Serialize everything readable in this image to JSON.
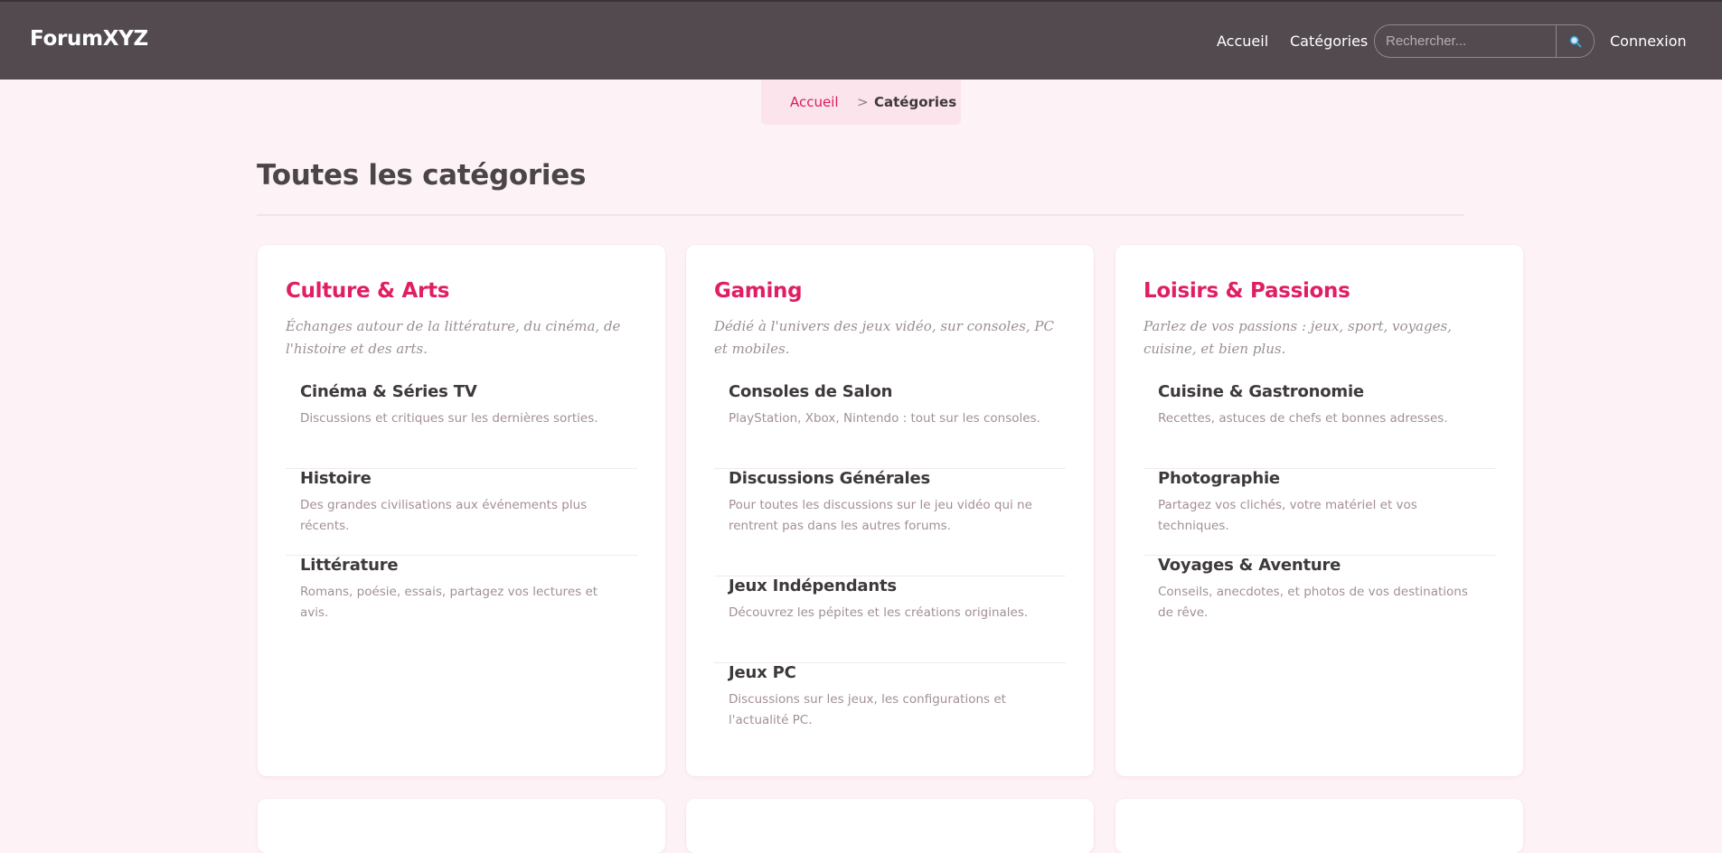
{
  "header": {
    "brand": "ForumXYZ",
    "nav": {
      "home": "Accueil",
      "categories": "Catégories",
      "login": "Connexion"
    },
    "search": {
      "placeholder": "Rechercher...",
      "value": "",
      "button_icon": "search-icon"
    }
  },
  "breadcrumb": {
    "home": "Accueil",
    "separator": ">",
    "current": "Catégories"
  },
  "page": {
    "title": "Toutes les catégories"
  },
  "categories": [
    {
      "title": "Culture & Arts",
      "description": "Échanges autour de la littérature, du cinéma, de l'histoire et des arts.",
      "forums": [
        {
          "name": "Cinéma & Séries TV",
          "description": "Discussions et critiques sur les dernières sorties."
        },
        {
          "name": "Histoire",
          "description": "Des grandes civilisations aux événements plus récents."
        },
        {
          "name": "Littérature",
          "description": "Romans, poésie, essais, partagez vos lectures et avis."
        }
      ]
    },
    {
      "title": "Gaming",
      "description": "Dédié à l'univers des jeux vidéo, sur consoles, PC et mobiles.",
      "forums": [
        {
          "name": "Consoles de Salon",
          "description": "PlayStation, Xbox, Nintendo : tout sur les consoles."
        },
        {
          "name": "Discussions Générales",
          "description": "Pour toutes les discussions sur le jeu vidéo qui ne rentrent pas dans les autres forums."
        },
        {
          "name": "Jeux Indépendants",
          "description": "Découvrez les pépites et les créations originales."
        },
        {
          "name": "Jeux PC",
          "description": "Discussions sur les jeux, les configurations et l'actualité PC."
        }
      ]
    },
    {
      "title": "Loisirs & Passions",
      "description": "Parlez de vos passions : jeux, sport, voyages, cuisine, et bien plus.",
      "forums": [
        {
          "name": "Cuisine & Gastronomie",
          "description": "Recettes, astuces de chefs et bonnes adresses."
        },
        {
          "name": "Photographie",
          "description": "Partagez vos clichés, votre matériel et vos techniques."
        },
        {
          "name": "Voyages & Aventure",
          "description": "Conseils, anecdotes, et photos de vos destinations de rêve."
        }
      ]
    }
  ],
  "colors": {
    "header_bg": "#524a4f",
    "accent": "#e01e63",
    "page_bg": "#fdf3f6",
    "breadcrumb_bg": "#fce4ec"
  }
}
